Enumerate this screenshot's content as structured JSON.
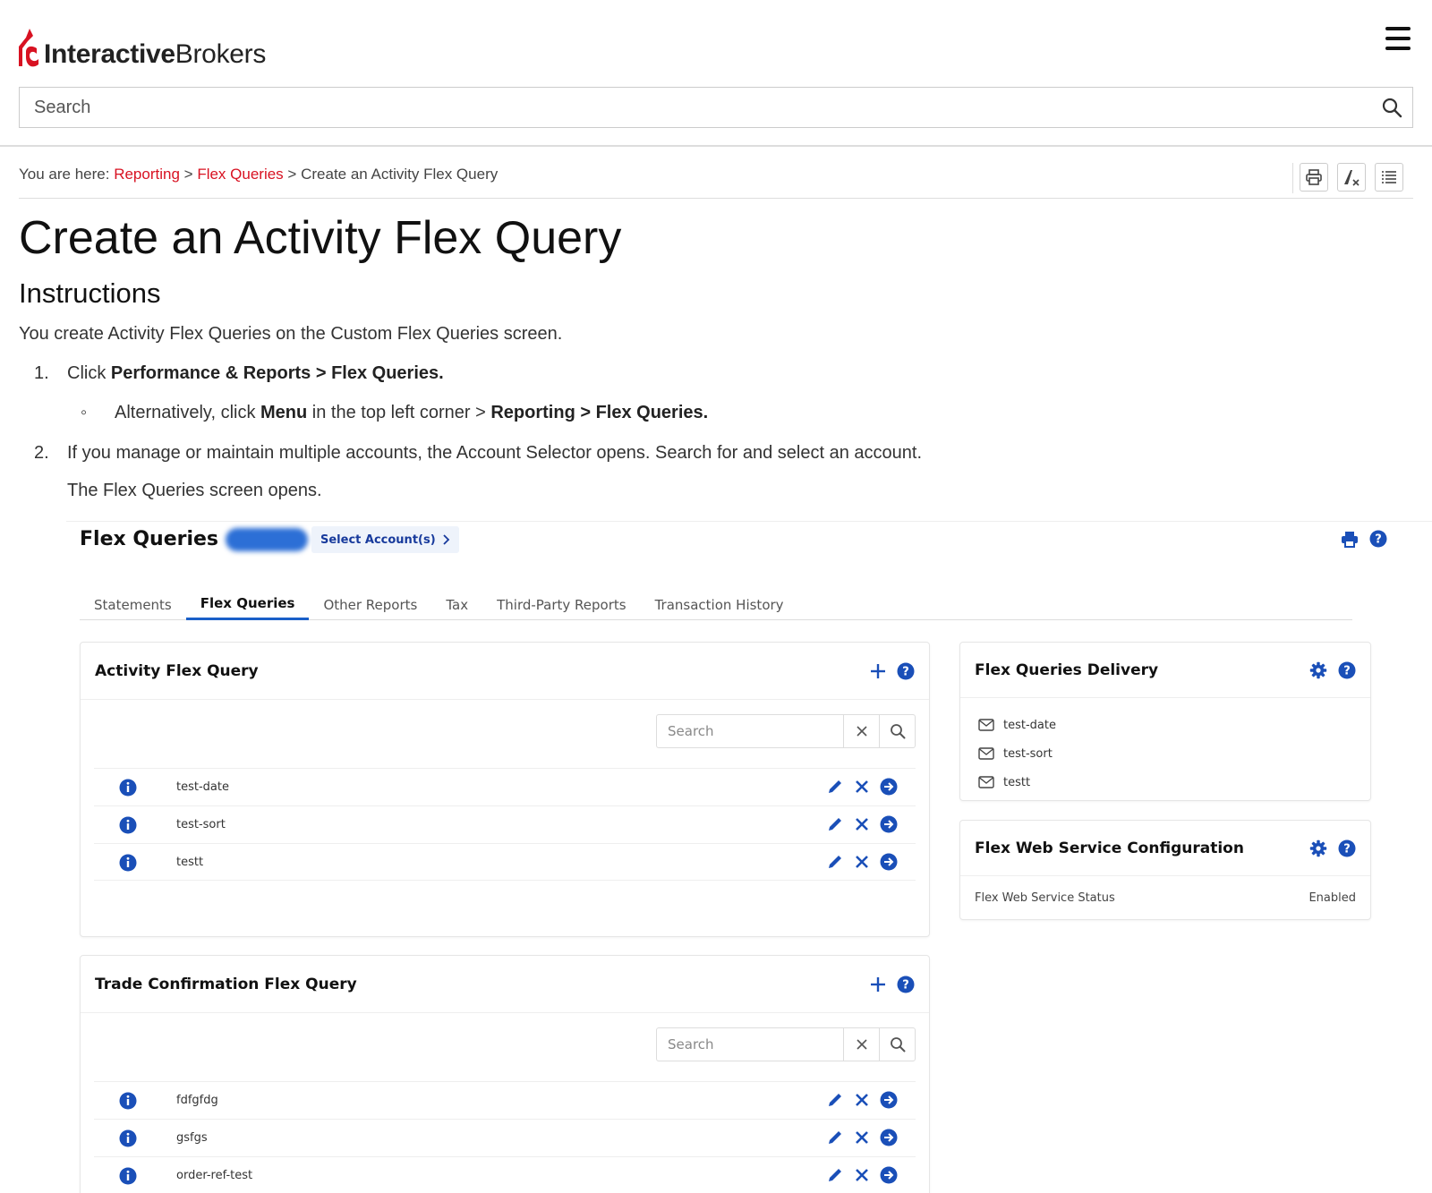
{
  "header": {
    "logo_bold": "Interactive",
    "logo_light": "Brokers",
    "search_placeholder": "Search"
  },
  "breadcrumb": {
    "prefix": "You are here:",
    "items": [
      "Reporting",
      "Flex Queries"
    ],
    "current": "Create an Activity Flex Query",
    "separator": ">"
  },
  "page": {
    "title": "Create an Activity Flex Query",
    "subtitle": "Instructions",
    "intro": "You create Activity Flex Queries on the Custom Flex Queries screen.",
    "steps": [
      {
        "num": "1.",
        "text_pre": "Click ",
        "bold": "Performance & Reports > Flex Queries.",
        "sub": {
          "bullet": "◦",
          "pre": "Alternatively, click ",
          "bold1": "Menu",
          "mid": " in the top left corner > ",
          "bold2": "Reporting > Flex Queries."
        }
      },
      {
        "num": "2.",
        "text": "If you manage or maintain multiple accounts, the Account Selector opens. Search for and select an account.",
        "followup": "The Flex Queries screen opens."
      }
    ]
  },
  "flex": {
    "title": "Flex Queries",
    "select_accounts": "Select Account(s)",
    "tabs": [
      "Statements",
      "Flex Queries",
      "Other Reports",
      "Tax",
      "Third-Party Reports",
      "Transaction History"
    ],
    "active_tab": "Flex Queries",
    "activity_card": {
      "title": "Activity Flex Query",
      "search_placeholder": "Search",
      "queries": [
        "test-date",
        "test-sort",
        "testt"
      ]
    },
    "trade_card": {
      "title": "Trade Confirmation Flex Query",
      "search_placeholder": "Search",
      "queries": [
        "fdfgfdg",
        "gsfgs",
        "order-ref-test"
      ]
    },
    "delivery_card": {
      "title": "Flex Queries Delivery",
      "items": [
        "test-date",
        "test-sort",
        "testt"
      ]
    },
    "webservice_card": {
      "title": "Flex Web Service Configuration",
      "status_label": "Flex Web Service Status",
      "status_value": "Enabled"
    }
  },
  "colors": {
    "brand_red": "#d81222",
    "accent_blue": "#1a4fb8",
    "link_red": "#d81222"
  }
}
